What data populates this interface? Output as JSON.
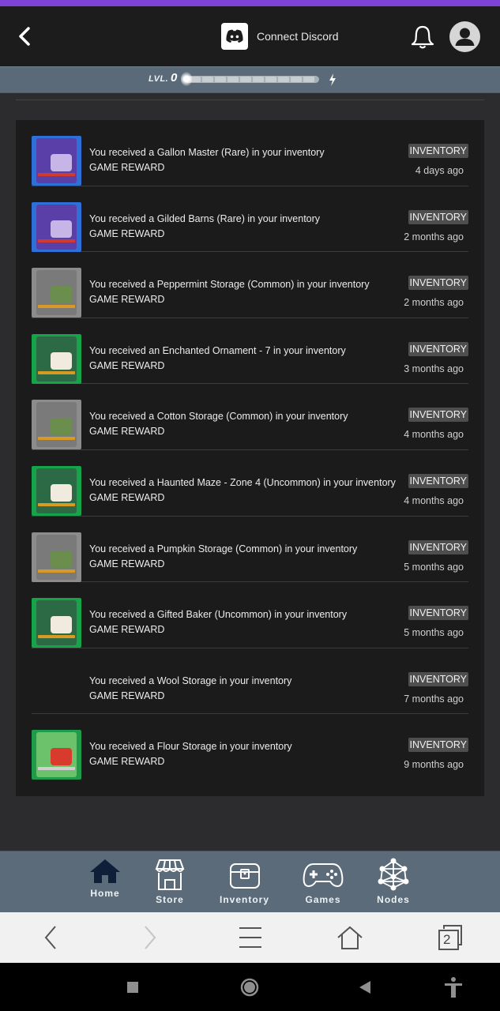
{
  "header": {
    "discord_label": "Connect Discord"
  },
  "level": {
    "label": "LVL.",
    "value": "0",
    "progress": 0.0
  },
  "colors": {
    "accent_purple": "#7c43d6",
    "rare": "#2f6fd8",
    "common": "#8c8c8c",
    "uncommon": "#16a34a"
  },
  "notifications": [
    {
      "message": "You received a Gallon Master (Rare) in your inventory",
      "source": "GAME REWARD",
      "badge": "INVENTORY",
      "time": "4 days ago",
      "rarity": "rare",
      "icon": "card-gallon-master"
    },
    {
      "message": "You received a Gilded Barns (Rare) in your inventory",
      "source": "GAME REWARD",
      "badge": "INVENTORY",
      "time": "2 months ago",
      "rarity": "rare",
      "icon": "card-gilded-barns"
    },
    {
      "message": "You received a Peppermint Storage (Common) in your inventory",
      "source": "GAME REWARD",
      "badge": "INVENTORY",
      "time": "2 months ago",
      "rarity": "common",
      "icon": "card-peppermint-storage"
    },
    {
      "message": "You received an Enchanted Ornament - 7 in your inventory",
      "source": "GAME REWARD",
      "badge": "INVENTORY",
      "time": "3 months ago",
      "rarity": "uncommon",
      "icon": "card-enchanted-ornament"
    },
    {
      "message": "You received a Cotton Storage (Common) in your inventory",
      "source": "GAME REWARD",
      "badge": "INVENTORY",
      "time": "4 months ago",
      "rarity": "common",
      "icon": "card-cotton-storage"
    },
    {
      "message": "You received a Haunted Maze - Zone 4 (Uncommon) in your inventory",
      "source": "GAME REWARD",
      "badge": "INVENTORY",
      "time": "4 months ago",
      "rarity": "uncommon",
      "icon": "card-haunted-maze"
    },
    {
      "message": "You received a Pumpkin Storage (Common) in your inventory",
      "source": "GAME REWARD",
      "badge": "INVENTORY",
      "time": "5 months ago",
      "rarity": "common",
      "icon": "card-pumpkin-storage"
    },
    {
      "message": "You received a Gifted Baker (Uncommon) in your inventory",
      "source": "GAME REWARD",
      "badge": "INVENTORY",
      "time": "5 months ago",
      "rarity": "uncommon",
      "icon": "card-gifted-baker"
    },
    {
      "message": "You received a Wool Storage in your inventory",
      "source": "GAME REWARD",
      "badge": "INVENTORY",
      "time": "7 months ago",
      "rarity": "none",
      "icon": ""
    },
    {
      "message": "You received a Flour Storage in your inventory",
      "source": "GAME REWARD",
      "badge": "INVENTORY",
      "time": "9 months ago",
      "rarity": "house",
      "icon": "card-flour-storage"
    }
  ],
  "nav": {
    "items": [
      {
        "label": "Home",
        "icon": "home-icon"
      },
      {
        "label": "Store",
        "icon": "store-icon"
      },
      {
        "label": "Inventory",
        "icon": "chest-icon"
      },
      {
        "label": "Games",
        "icon": "gamepad-icon"
      },
      {
        "label": "Nodes",
        "icon": "nodes-icon"
      }
    ]
  },
  "browser": {
    "tab_count": "2"
  }
}
